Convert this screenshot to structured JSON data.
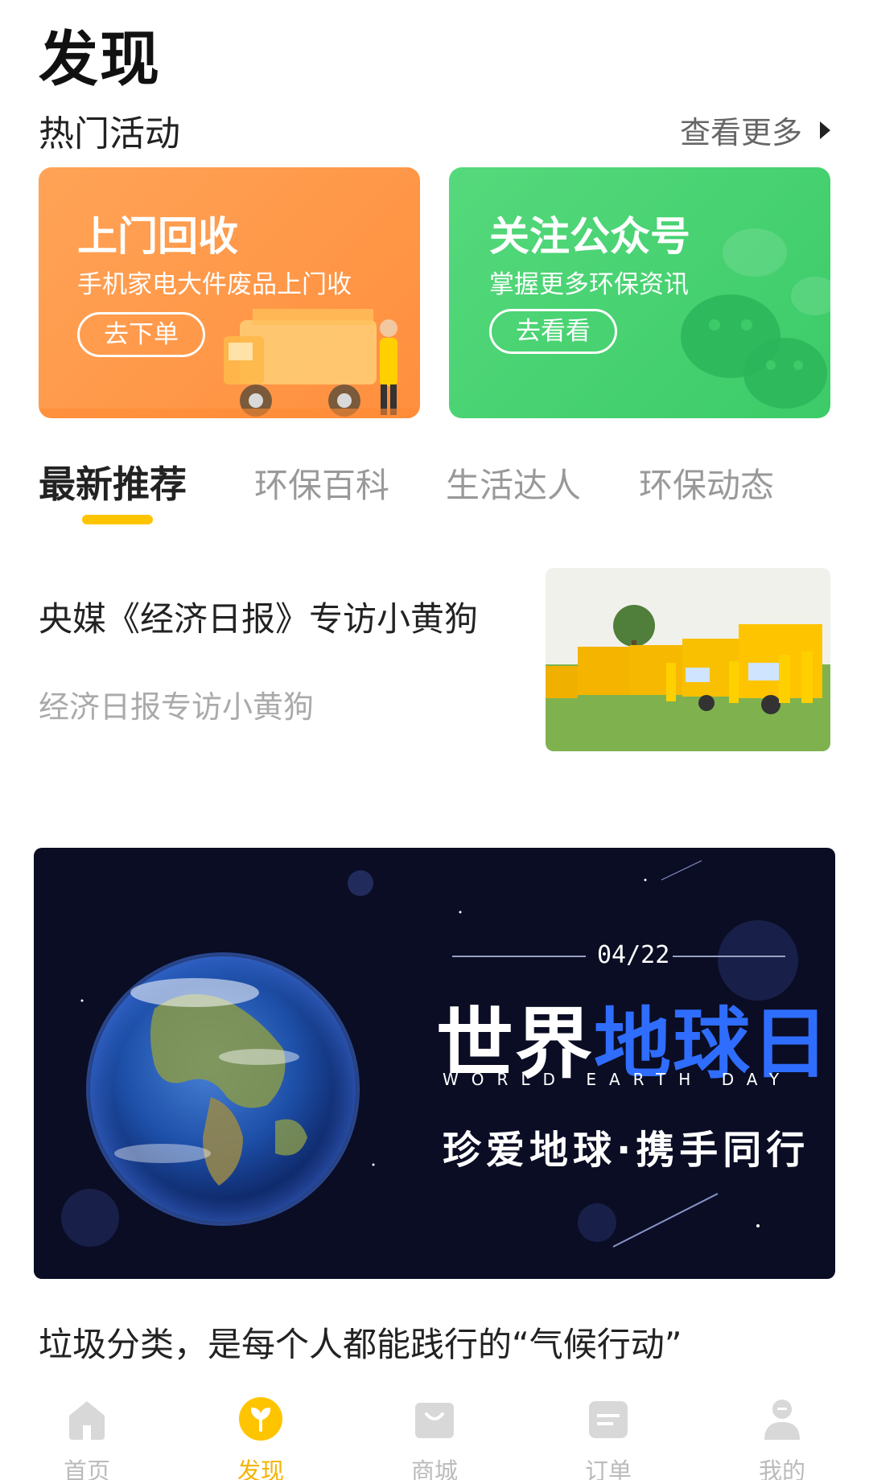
{
  "page": {
    "title": "发现"
  },
  "hot_section": {
    "title": "热门活动",
    "see_more": "查看更多"
  },
  "activity_cards": [
    {
      "title": "上门回收",
      "subtitle": "手机家电大件废品上门收",
      "button": "去下单",
      "color": "#ff9a48"
    },
    {
      "title": "关注公众号",
      "subtitle": "掌握更多环保资讯",
      "button": "去看看",
      "color": "#46d170"
    }
  ],
  "tabs": [
    {
      "label": "最新推荐",
      "active": true
    },
    {
      "label": "环保百科",
      "active": false
    },
    {
      "label": "生活达人",
      "active": false
    },
    {
      "label": "环保动态",
      "active": false
    }
  ],
  "articles": [
    {
      "title": "央媒《经济日报》专访小黄狗",
      "description": "经济日报专访小黄狗"
    }
  ],
  "banner": {
    "date": "04/22",
    "title_part1": "世界",
    "title_part2": "地球日",
    "subtitle_en": "WORLD EARTH DAY",
    "slogan": "珍爱地球·携手同行"
  },
  "article2": {
    "title": "垃圾分类，是每个人都能践行的“气候行动”"
  },
  "bottom_nav": [
    {
      "label": "首页",
      "icon": "home-icon",
      "active": false
    },
    {
      "label": "发现",
      "icon": "discover-icon",
      "active": true
    },
    {
      "label": "商城",
      "icon": "shop-icon",
      "active": false
    },
    {
      "label": "订单",
      "icon": "order-icon",
      "active": false
    },
    {
      "label": "我的",
      "icon": "profile-icon",
      "active": false
    }
  ],
  "colors": {
    "accent": "#ffc400",
    "active_nav": "#f4b400",
    "inactive": "#bbbbbb"
  }
}
